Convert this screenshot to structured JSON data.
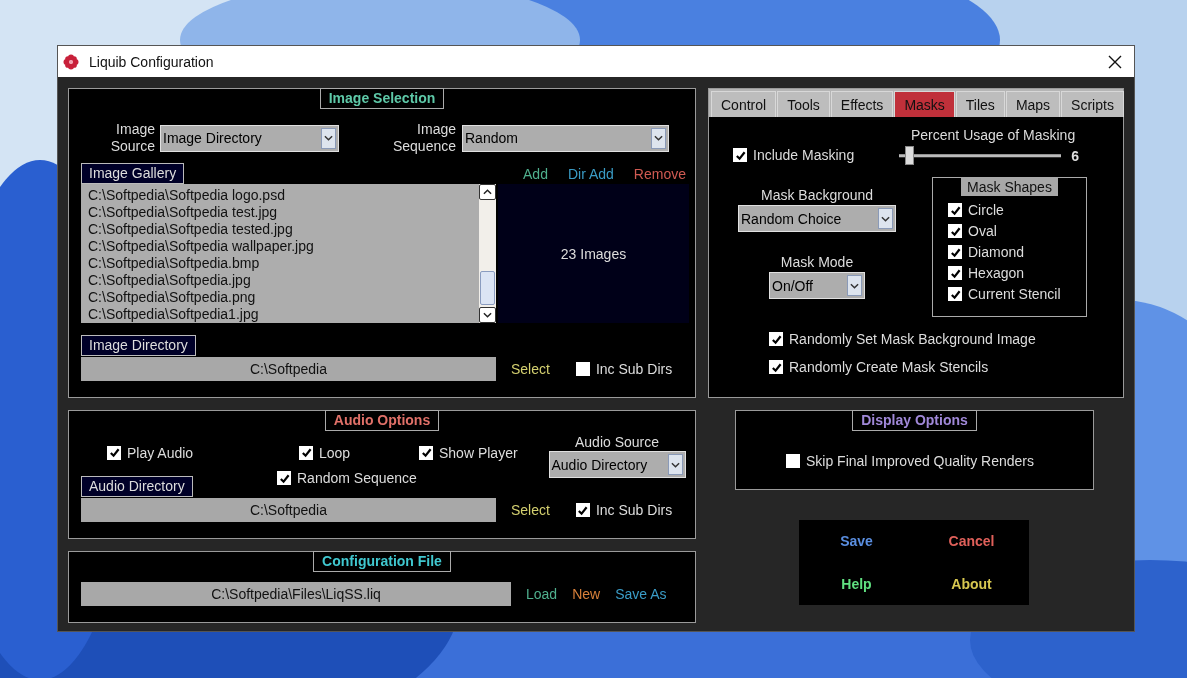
{
  "window": {
    "title": "Liquib Configuration"
  },
  "image_selection": {
    "title": "Image Selection",
    "color": "#5ec9a8",
    "source": {
      "label": "Image Source",
      "value": "Image Directory"
    },
    "sequence": {
      "label": "Image Sequence",
      "value": "Random"
    },
    "gallery": {
      "label": "Image Gallery",
      "count": "23 Images",
      "actions": [
        {
          "label": "Add",
          "color": "#4fb08e"
        },
        {
          "label": "Dir Add",
          "color": "#3a9cc6"
        },
        {
          "label": "Remove",
          "color": "#d05a52"
        }
      ],
      "items": [
        "C:\\Softpedia\\Softpedia logo.psd",
        "C:\\Softpedia\\Softpedia test.jpg",
        "C:\\Softpedia\\Softpedia tested.jpg",
        "C:\\Softpedia\\Softpedia wallpaper.jpg",
        "C:\\Softpedia\\Softpedia.bmp",
        "C:\\Softpedia\\Softpedia.jpg",
        "C:\\Softpedia\\Softpedia.png",
        "C:\\Softpedia\\Softpedia1.jpg"
      ]
    },
    "directory": {
      "label": "Image Directory",
      "value": "C:\\Softpedia",
      "select": "Select",
      "inc_sub_dirs": {
        "label": "Inc Sub Dirs",
        "checked": false
      }
    }
  },
  "audio_options": {
    "title": "Audio Options",
    "color": "#e07068",
    "checkboxes": [
      {
        "label": "Play Audio",
        "checked": true
      },
      {
        "label": "Loop",
        "checked": true
      },
      {
        "label": "Show Player",
        "checked": true
      },
      {
        "label": "Random Sequence",
        "checked": true
      }
    ],
    "source": {
      "label": "Audio Source",
      "value": "Audio Directory"
    },
    "directory": {
      "label": "Audio Directory",
      "value": "C:\\Softpedia",
      "select": "Select",
      "inc_sub_dirs": {
        "label": "Inc Sub Dirs",
        "checked": true
      }
    }
  },
  "configuration_file": {
    "title": "Configuration File",
    "color": "#40c8d0",
    "value": "C:\\Softpedia\\Files\\LiqSS.liq",
    "actions": [
      {
        "label": "Load",
        "color": "#4fb08e"
      },
      {
        "label": "New",
        "color": "#d8803a"
      },
      {
        "label": "Save As",
        "color": "#3a9cc6"
      }
    ]
  },
  "tabs": [
    {
      "label": "Control",
      "selected": false
    },
    {
      "label": "Tools",
      "selected": false
    },
    {
      "label": "Effects",
      "selected": false
    },
    {
      "label": "Masks",
      "selected": true
    },
    {
      "label": "Tiles",
      "selected": false
    },
    {
      "label": "Maps",
      "selected": false
    },
    {
      "label": "Scripts",
      "selected": false
    }
  ],
  "masks": {
    "include_masking": {
      "label": "Include Masking",
      "checked": true
    },
    "usage": {
      "label": "Percent Usage of Masking",
      "level": 0.06,
      "reading": "6"
    },
    "background": {
      "label": "Mask Background",
      "value": "Random Choice"
    },
    "mode": {
      "label": "Mask Mode",
      "value": "On/Off"
    },
    "shapes": {
      "title": "Mask Shapes",
      "items": [
        {
          "label": "Circle",
          "checked": true
        },
        {
          "label": "Oval",
          "checked": true
        },
        {
          "label": "Diamond",
          "checked": true
        },
        {
          "label": "Hexagon",
          "checked": true
        },
        {
          "label": "Current Stencil",
          "checked": true
        }
      ]
    },
    "options": [
      {
        "label": "Randomly Set Mask Background Image",
        "checked": true
      },
      {
        "label": "Randomly Create Mask Stencils",
        "checked": true
      }
    ]
  },
  "display_options": {
    "title": "Display Options",
    "color": "#a088d8",
    "checkbox": {
      "label": "Skip Final Improved Quality Renders",
      "checked": false
    }
  },
  "buttons": [
    {
      "label": "Save",
      "color": "#5a8ee0"
    },
    {
      "label": "Cancel",
      "color": "#e0605a"
    },
    {
      "label": "Help",
      "color": "#60e080"
    },
    {
      "label": "About",
      "color": "#d8c850"
    }
  ]
}
